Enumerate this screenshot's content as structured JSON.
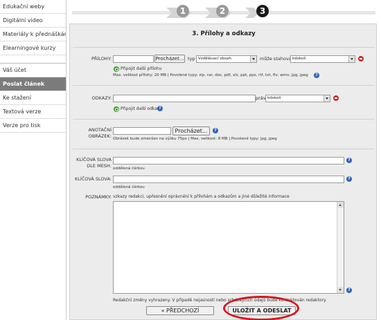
{
  "sidebar": {
    "items_top": [
      {
        "label": "Edukační weby"
      },
      {
        "label": "Digitální video"
      },
      {
        "label": "Materiály k přednáškám"
      },
      {
        "label": "Elearningové kurzy"
      }
    ],
    "items_bottom": [
      {
        "label": "Váš účet"
      },
      {
        "label": "Poslat článek",
        "active": true
      },
      {
        "label": "Ke stažení"
      },
      {
        "label": "Textová verze"
      },
      {
        "label": "Verze pro tisk"
      }
    ]
  },
  "steps": {
    "items": [
      {
        "number": "1",
        "state": "done"
      },
      {
        "number": "2",
        "state": "done"
      },
      {
        "number": "3",
        "state": "current"
      }
    ]
  },
  "form": {
    "title": "3. Přílohy a odkazy",
    "attachments": {
      "label": "PŘÍLOHY:",
      "browse_label": "Procházet...",
      "type_label": "typ",
      "type_value": "Vzdělávací obsah",
      "download_label": "může stahovat",
      "download_value": "kdokoli",
      "add_label": "Připojit další přílohu",
      "info": "Max. velikost přílohy: 20 MB | Povolené typy: zip, rar, doc, pdf, xls, ppt, pps, rtf, txt, flv, wmv, jpg, jpeg"
    },
    "links": {
      "label": "ODKAZY:",
      "rights_label": "práva",
      "rights_value": "kdokoli",
      "add_label": "Připojit další odkaz"
    },
    "annotation_image": {
      "label_line1": "ANOTAČNÍ",
      "label_line2": "OBRÁZEK:",
      "browse_label": "Procházet...",
      "info": "Obrázek bude zmenšen na výšku 75px | Max. velikost: 8 MB | Povolené typy: jpg, jpeg"
    },
    "mesh_keywords": {
      "label_line1": "KLÍČOVÁ SLOVA",
      "label_line2": "DLE MESH:",
      "hint": "oddělená čárkou"
    },
    "keywords": {
      "label": "KLÍČOVÁ SLOVA:",
      "hint": "oddělená čárkou"
    },
    "notes": {
      "label": "POZNÁMKY:",
      "hint": "vzkazy redakci, upřesnění oprávnění k přílohám a odkazům a jiné důležité informace"
    },
    "footer_note": "Redakční změny vyhrazeny. V případě nejasností nebo scházejících údajů bude kontaktován redaktory.",
    "prev_button": "« PŘEDCHOZÍ",
    "submit_button": "ULOŽIT A ODESLAT"
  },
  "colors": {
    "active_sidebar": "#7b7b7b",
    "highlight": "#d8151b",
    "help_icon": "#2f62b8",
    "remove_icon": "#cc2a2a",
    "add_icon": "#3d9a2f"
  }
}
